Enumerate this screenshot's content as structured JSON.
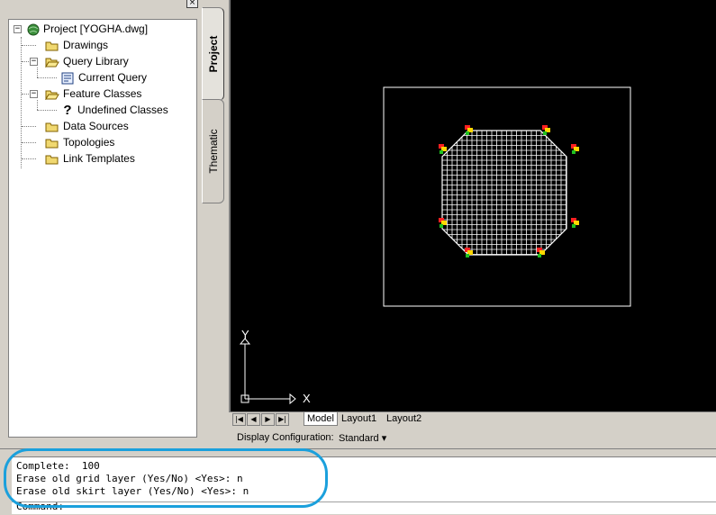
{
  "project_panel": {
    "close_glyph": "×",
    "tree": [
      {
        "label": "Project [YOGHA.dwg]",
        "icon": "globe-icon"
      },
      {
        "label": "Drawings",
        "icon": "folder-icon"
      },
      {
        "label": "Query Library",
        "icon": "folder-open-icon"
      },
      {
        "label": "Current Query",
        "icon": "query-icon"
      },
      {
        "label": "Feature Classes",
        "icon": "folder-open-icon"
      },
      {
        "label": "Undefined Classes",
        "icon": "question-icon"
      },
      {
        "label": "Data Sources",
        "icon": "folder-icon"
      },
      {
        "label": "Topologies",
        "icon": "folder-icon"
      },
      {
        "label": "Link Templates",
        "icon": "folder-icon"
      }
    ]
  },
  "side_tabs": {
    "project": "Project",
    "thematic": "Thematic"
  },
  "canvas": {
    "axis_y": "Y",
    "axis_x": "X"
  },
  "layout_tabs": {
    "nav": [
      "|◀",
      "◀",
      "▶",
      "▶|"
    ],
    "model": "Model",
    "layout1": "Layout1",
    "layout2": "Layout2"
  },
  "display_config": {
    "label": "Display Configuration:",
    "value": "Standard ▾"
  },
  "command": {
    "lines": [
      "Complete:  100",
      "Erase old grid layer (Yes/No) <Yes>: n",
      "Erase old skirt layer (Yes/No) <Yes>: n"
    ],
    "prompt": "Command:"
  },
  "colors": {
    "highlight": "#1ba0dc",
    "canvas_bg": "#000000",
    "grid": "#ffffff"
  }
}
